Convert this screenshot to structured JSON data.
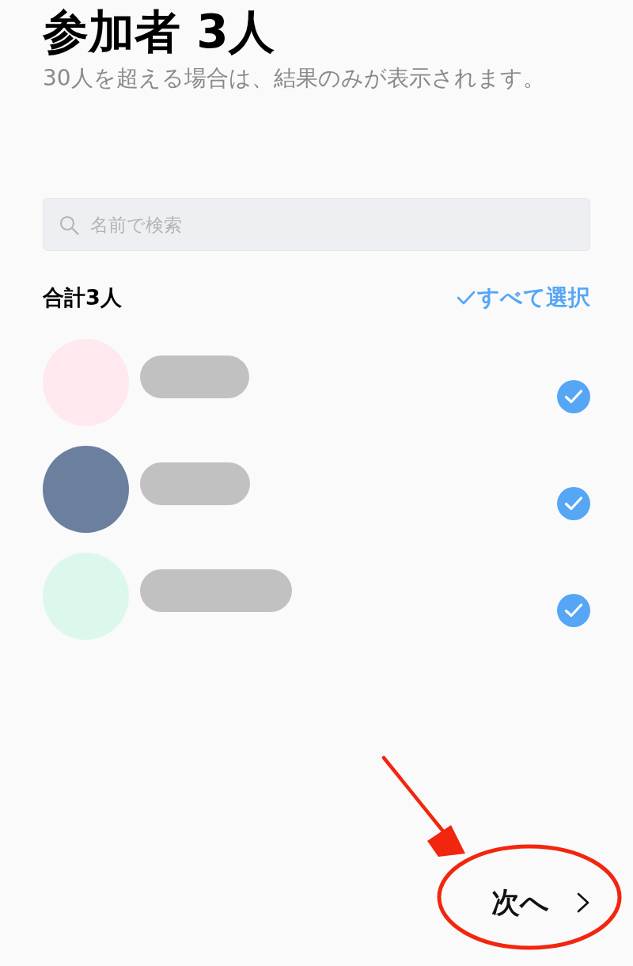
{
  "header": {
    "title": "参加者 3人",
    "subtitle": "30人を超える場合は、結果のみが表示されます。"
  },
  "search": {
    "placeholder": "名前で検索"
  },
  "summary": {
    "total": "合計3人",
    "select_all": "すべて選択"
  },
  "participants": [
    {
      "color": "#ffe8ee",
      "selected": true
    },
    {
      "color": "#6b7f9e",
      "selected": true
    },
    {
      "color": "#dcf8ec",
      "selected": true
    }
  ],
  "next_button": {
    "label": "次へ"
  },
  "annotation": {
    "visible": true
  }
}
